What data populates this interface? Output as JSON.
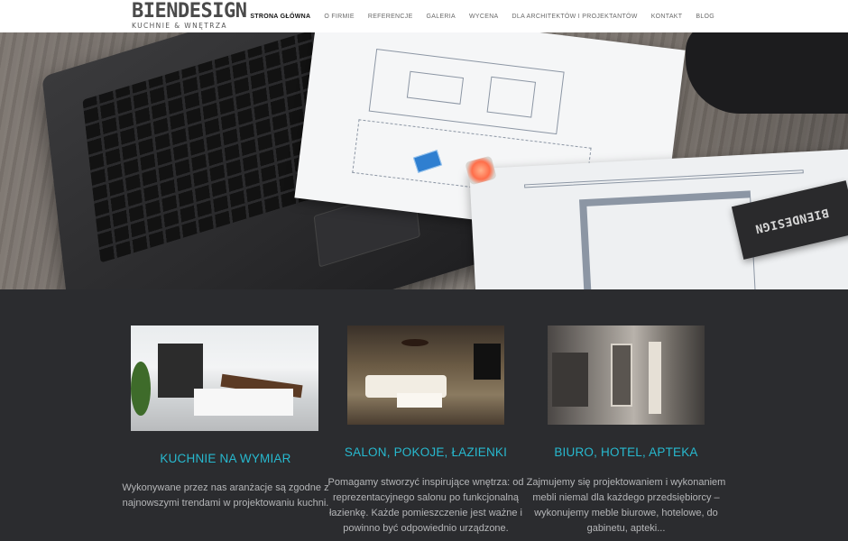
{
  "logo": {
    "name": "BIENDESIGN",
    "tagline": "KUCHNIE & WNĘTRZA"
  },
  "nav": {
    "items": [
      {
        "label": "STRONA GŁÓWNA",
        "active": true
      },
      {
        "label": "O FIRMIE",
        "active": false
      },
      {
        "label": "REFERENCJE",
        "active": false
      },
      {
        "label": "GALERIA",
        "active": false
      },
      {
        "label": "WYCENA",
        "active": false
      },
      {
        "label": "DLA ARCHITEKTÓW I PROJEKTANTÓW",
        "active": false
      },
      {
        "label": "KONTAKT",
        "active": false
      },
      {
        "label": "BLOG",
        "active": false
      }
    ]
  },
  "hero": {
    "card_text": "BIENDESIGN"
  },
  "features": [
    {
      "title": "KUCHNIE NA WYMIAR",
      "text": "Wykonywane przez nas aranżacje są zgodne z najnowszymi trendami w projektowaniu kuchni."
    },
    {
      "title": "SALON, POKOJE, ŁAZIENKI",
      "text": "Pomagamy stworzyć inspirujące wnętrza: od reprezentacyjnego salonu po funkcjonalną łazienkę. Każde pomieszczenie jest ważne i powinno być odpowiednio urządzone."
    },
    {
      "title": "BIURO, HOTEL, APTEKA",
      "text": "Zajmujemy się projektowaniem i wykonaniem mebli niemal dla każdego przedsiębiorcy – wykonujemy meble biurowe, hotelowe, do gabinetu, apteki..."
    }
  ],
  "colors": {
    "accent": "#27b9cf",
    "content_bg": "#2b2c2f",
    "header_bg": "#ffffff"
  }
}
